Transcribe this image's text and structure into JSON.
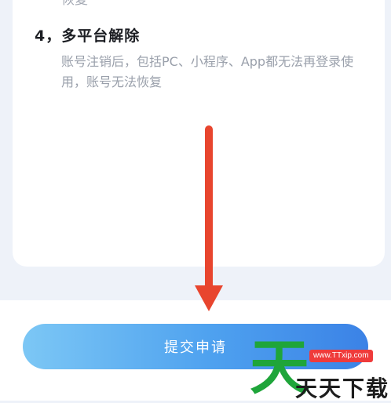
{
  "content": {
    "cut_off_text": "恢复",
    "section_title": "4，多平台解除",
    "section_desc": "账号注销后，包括PC、小程序、App都无法再登录使用，账号无法恢复"
  },
  "footer": {
    "submit_label": "提交申请"
  },
  "watermark": {
    "big_char": "天",
    "url": "www.TTxip.com",
    "name": "天天下载"
  },
  "colors": {
    "annotation_arrow": "#e8452e",
    "button_gradient_start": "#7cc7f5",
    "button_gradient_end": "#3b82e6",
    "watermark_green": "#1fa53a"
  },
  "icons": {
    "annotation": "arrow-down-icon"
  }
}
